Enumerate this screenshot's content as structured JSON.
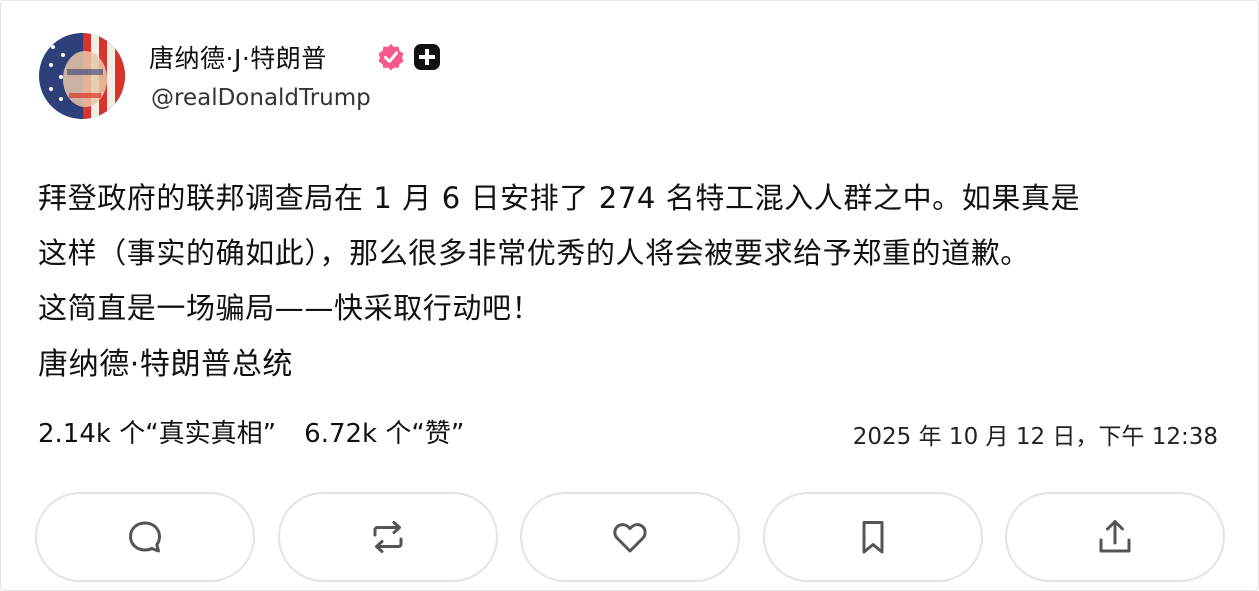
{
  "author": {
    "name": "唐纳德·J·特朗普",
    "handle": "@realDonaldTrump"
  },
  "post": {
    "lines": [
      "拜登政府的联邦调查局在 1 月 6 日安排了 274 名特工混入人群之中。如果真是",
      "这样（事实的确如此），那么很多非常优秀的人将会被要求给予郑重的道歉。",
      "这简直是一场骗局——快采取行动吧！"
    ],
    "signature": "唐纳德·特朗普总统"
  },
  "stats": {
    "truths": "2.14k 个“真实真相”",
    "likes": "6.72k 个“赞”"
  },
  "timestamp": "2025 年 10 月 12 日，下午 12:38",
  "colors": {
    "verified_badge": "#f7578c",
    "plus_badge": "#111111",
    "button_border": "#e4e4e4",
    "icon_stroke": "#555555"
  },
  "icons": {
    "verified": "verified-badge-icon",
    "plus": "plus-badge-icon",
    "reply": "reply-icon",
    "retruth": "retruth-icon",
    "like": "heart-icon",
    "bookmark": "bookmark-icon",
    "share": "share-icon"
  }
}
